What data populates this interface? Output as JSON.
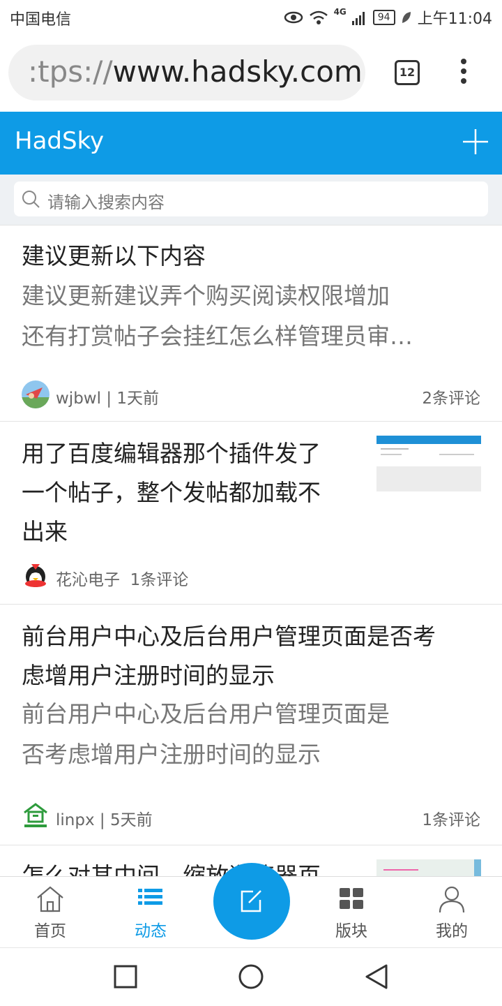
{
  "status_bar": {
    "carrier": "中国电信",
    "signal_label": "4G",
    "battery": "94",
    "time": "上午11:04"
  },
  "browser": {
    "url_prefix": ":tps://",
    "url_host": "www.hadsky.com",
    "tab_count": "12"
  },
  "app": {
    "title": "HadSky",
    "brand_color": "#0e9be6"
  },
  "search": {
    "placeholder": "请输入搜索内容"
  },
  "posts": [
    {
      "title": "建议更新以下内容",
      "body_line1": "建议更新建议弄个购买阅读权限增加",
      "body_line2": "还有打赏帖子会挂红怎么样管理员审…",
      "author": "wjbwl",
      "time": "1天前",
      "comments": "2条评论"
    },
    {
      "title_line1": "用了百度编辑器那个插件发了",
      "title_line2": "一个帖子，整个发帖都加载不",
      "title_line3": "出来",
      "author": "花沁电子",
      "comments": "1条评论"
    },
    {
      "title_line1": "前台用户中心及后台用户管理页面是否考",
      "title_line2": "虑增用户注册时间的显示",
      "body_line1": "前台用户中心及后台用户管理页面是",
      "body_line2": "否考虑增用户注册时间的显示",
      "author": "linpx",
      "time": "5天前",
      "comments": "1条评论"
    },
    {
      "title_partial": "怎么对其中间，缩放浏览器页"
    }
  ],
  "bottom_nav": {
    "items": [
      {
        "label": "首页",
        "icon": "home-icon"
      },
      {
        "label": "动态",
        "icon": "list-icon",
        "active": true
      },
      {
        "label": "版块",
        "icon": "grid-icon"
      },
      {
        "label": "我的",
        "icon": "user-icon"
      }
    ],
    "fab_icon": "compose-icon"
  }
}
